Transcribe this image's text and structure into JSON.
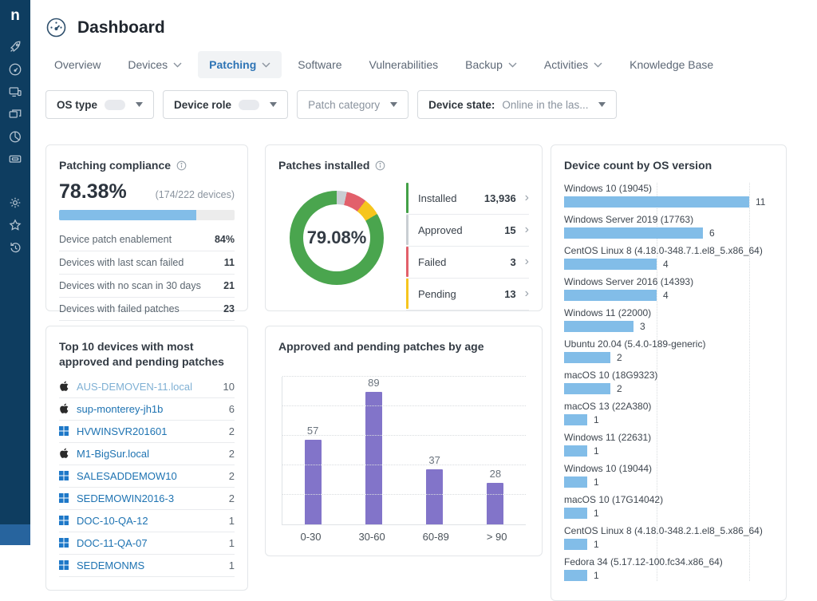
{
  "header": {
    "title": "Dashboard"
  },
  "sidebar": {
    "logo": "n",
    "icons_top": [
      "rocket-icon",
      "gauge-icon",
      "remote-devices-icon",
      "multi-device-icon",
      "pie-chart-icon",
      "ticket-icon"
    ],
    "icons_bottom": [
      "gear-icon",
      "star-icon",
      "history-icon"
    ]
  },
  "tabs": [
    {
      "label": "Overview",
      "caret": false,
      "active": false
    },
    {
      "label": "Devices",
      "caret": true,
      "active": false
    },
    {
      "label": "Patching",
      "caret": true,
      "active": true
    },
    {
      "label": "Software",
      "caret": false,
      "active": false
    },
    {
      "label": "Vulnerabilities",
      "caret": false,
      "active": false
    },
    {
      "label": "Backup",
      "caret": true,
      "active": false
    },
    {
      "label": "Activities",
      "caret": true,
      "active": false
    },
    {
      "label": "Knowledge Base",
      "caret": false,
      "active": false
    }
  ],
  "filters": [
    {
      "label": "OS type",
      "pill": true,
      "value": "",
      "muted": false
    },
    {
      "label": "Device role",
      "pill": true,
      "value": "",
      "muted": false
    },
    {
      "label": "Patch category",
      "pill": false,
      "value": "",
      "muted": true
    },
    {
      "label": "Device state:",
      "pill": false,
      "value": "Online in the las...",
      "muted": false
    }
  ],
  "compliance": {
    "title": "Patching compliance",
    "percent": "78.38%",
    "devices": "(174/222 devices)",
    "progress_pct": 78,
    "bar_color": "#82bde8",
    "rows": [
      {
        "label": "Device patch enablement",
        "value": "84%"
      },
      {
        "label": "Devices with last scan failed",
        "value": "11"
      },
      {
        "label": "Devices with no scan in 30 days",
        "value": "21"
      },
      {
        "label": "Devices with failed patches",
        "value": "23"
      }
    ]
  },
  "patches_installed": {
    "title": "Patches installed",
    "center": "79.08%",
    "legend": [
      {
        "label": "Installed",
        "value": "13,936",
        "color": "#43a047"
      },
      {
        "label": "Approved",
        "value": "15",
        "color": "#c9ced3"
      },
      {
        "label": "Failed",
        "value": "3",
        "color": "#e2606b"
      },
      {
        "label": "Pending",
        "value": "13",
        "color": "#f6c51e"
      }
    ],
    "donut_segments": [
      {
        "color": "#c9ced3",
        "pct": 3.5
      },
      {
        "color": "#e2606b",
        "pct": 7.0
      },
      {
        "color": "#f6c51e",
        "pct": 6.0
      },
      {
        "color": "#4aa54e",
        "pct": 83.5
      }
    ]
  },
  "os_versions": {
    "title": "Device count by OS version",
    "axis_max": 8,
    "bar_color": "#82bde8",
    "items": [
      {
        "label": "Windows 10 (19045)",
        "value": 11
      },
      {
        "label": "Windows Server 2019 (17763)",
        "value": 6
      },
      {
        "label": "CentOS Linux 8 (4.18.0-348.7.1.el8_5.x86_64)",
        "value": 4
      },
      {
        "label": "Windows Server 2016 (14393)",
        "value": 4
      },
      {
        "label": "Windows 11 (22000)",
        "value": 3
      },
      {
        "label": "Ubuntu 20.04 (5.4.0-189-generic)",
        "value": 2
      },
      {
        "label": "macOS 10 (18G9323)",
        "value": 2
      },
      {
        "label": "macOS 13 (22A380)",
        "value": 1
      },
      {
        "label": "Windows 11 (22631)",
        "value": 1
      },
      {
        "label": "Windows 10 (19044)",
        "value": 1
      },
      {
        "label": "macOS 10 (17G14042)",
        "value": 1
      },
      {
        "label": "CentOS Linux 8 (4.18.0-348.2.1.el8_5.x86_64)",
        "value": 1
      },
      {
        "label": "Fedora 34 (5.17.12-100.fc34.x86_64)",
        "value": 1
      }
    ]
  },
  "top_devices": {
    "title": "Top 10 devices with most approved and pending patches",
    "items": [
      {
        "name": "AUS-DEMOVEN-11.local",
        "os": "mac",
        "value": "10",
        "muted": true
      },
      {
        "name": "sup-monterey-jh1b",
        "os": "mac",
        "value": "6",
        "muted": false
      },
      {
        "name": "HVWINSVR201601",
        "os": "windows",
        "value": "2",
        "muted": false
      },
      {
        "name": "M1-BigSur.local",
        "os": "mac",
        "value": "2",
        "muted": false
      },
      {
        "name": "SALESADDEMOW10",
        "os": "windows",
        "value": "2",
        "muted": false
      },
      {
        "name": "SEDEMOWIN2016-3",
        "os": "windows",
        "value": "2",
        "muted": false
      },
      {
        "name": "DOC-10-QA-12",
        "os": "windows",
        "value": "1",
        "muted": false
      },
      {
        "name": "DOC-11-QA-07",
        "os": "windows",
        "value": "1",
        "muted": false
      },
      {
        "name": "SEDEMONMS",
        "os": "windows",
        "value": "1",
        "muted": false
      }
    ]
  },
  "age_chart": {
    "title": "Approved and pending patches by age",
    "categories": [
      "0-30",
      "30-60",
      "60-89",
      "> 90"
    ],
    "values": [
      57,
      89,
      37,
      28
    ],
    "ymax": 100,
    "gridline_step": 20,
    "bar_color": "#8274c9"
  },
  "chart_data": [
    {
      "type": "pie",
      "title": "Patches installed",
      "center_label": "79.08%",
      "labels": [
        "Installed",
        "Approved",
        "Failed",
        "Pending"
      ],
      "values": [
        13936,
        15,
        3,
        13
      ],
      "colors": [
        "#4aa54e",
        "#c9ced3",
        "#e2606b",
        "#f6c51e"
      ],
      "legend_position": "right"
    },
    {
      "type": "bar",
      "orientation": "horizontal",
      "title": "Device count by OS version",
      "categories": [
        "Windows 10 (19045)",
        "Windows Server 2019 (17763)",
        "CentOS Linux 8 (4.18.0-348.7.1.el8_5.x86_64)",
        "Windows Server 2016 (14393)",
        "Windows 11 (22000)",
        "Ubuntu 20.04 (5.4.0-189-generic)",
        "macOS 10 (18G9323)",
        "macOS 13 (22A380)",
        "Windows 11 (22631)",
        "Windows 10 (19044)",
        "macOS 10 (17G14042)",
        "CentOS Linux 8 (4.18.0-348.2.1.el8_5.x86_64)",
        "Fedora 34 (5.17.12-100.fc34.x86_64)"
      ],
      "values": [
        11,
        6,
        4,
        4,
        3,
        2,
        2,
        1,
        1,
        1,
        1,
        1,
        1
      ],
      "xlim": [
        0,
        8
      ],
      "grid": "dotted-vertical"
    },
    {
      "type": "bar",
      "orientation": "vertical",
      "title": "Approved and pending patches by age",
      "categories": [
        "0-30",
        "30-60",
        "60-89",
        "> 90"
      ],
      "values": [
        57,
        89,
        37,
        28
      ],
      "ylim": [
        0,
        100
      ],
      "grid": "dotted-horizontal"
    }
  ]
}
